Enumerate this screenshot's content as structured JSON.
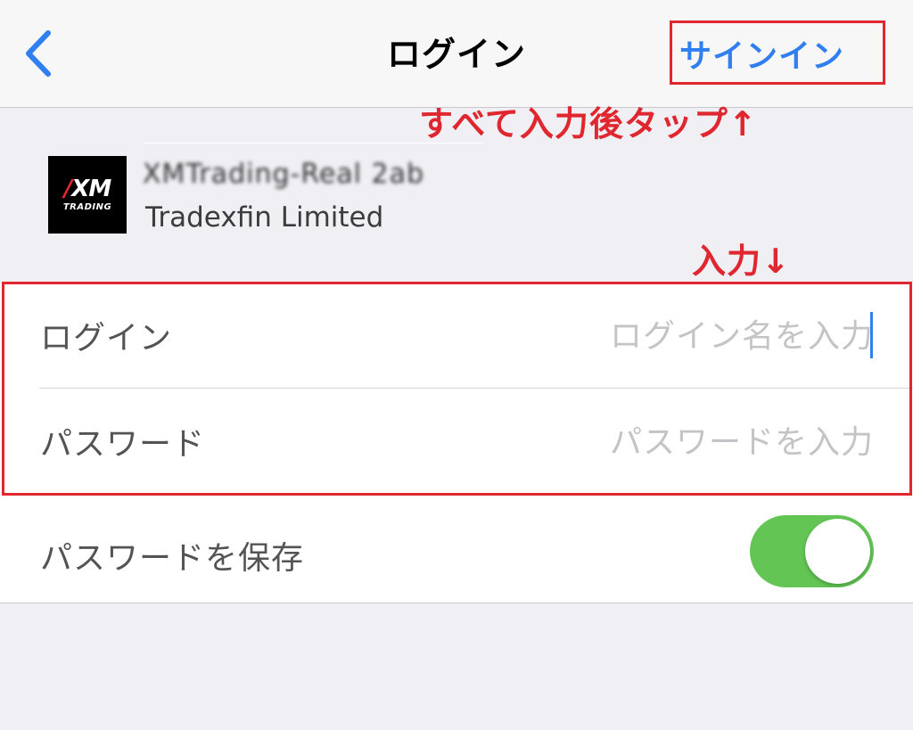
{
  "navbar": {
    "back_icon": "chevron-left-icon",
    "title": "ログイン",
    "signin_label": "サインイン"
  },
  "annotations": {
    "tap_after_input": "すべて入力後タップ↑",
    "input_here": "入力↓"
  },
  "server": {
    "logo_mark": "XM",
    "logo_sub": "TRADING",
    "server_name": "XMTrading-Real 2ab",
    "company": "Tradexfin Limited"
  },
  "form": {
    "login": {
      "label": "ログイン",
      "value": "",
      "placeholder": "ログイン名を入力"
    },
    "password": {
      "label": "パスワード",
      "value": "",
      "placeholder": "パスワードを入力"
    }
  },
  "save_password": {
    "label": "パスワードを保存",
    "enabled": true
  },
  "colors": {
    "accent_blue": "#2f7ff0",
    "annotation_red": "#e0262e",
    "toggle_green": "#62c554",
    "background": "#efeff4"
  }
}
